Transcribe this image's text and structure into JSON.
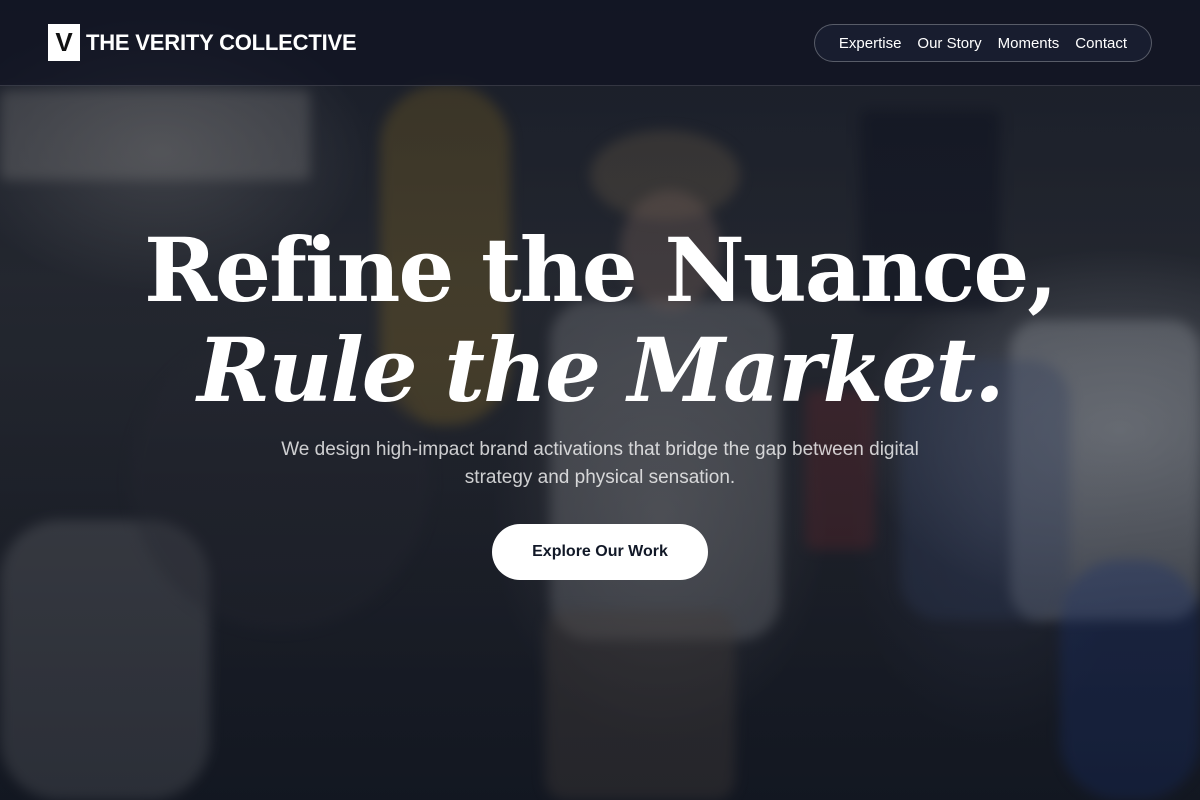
{
  "brand": {
    "mark": "V",
    "name": "THE VERITY COLLECTIVE"
  },
  "nav": {
    "items": [
      {
        "label": "Expertise"
      },
      {
        "label": "Our Story"
      },
      {
        "label": "Moments"
      },
      {
        "label": "Contact"
      }
    ]
  },
  "hero": {
    "headline_line1": "Refine the Nuance,",
    "headline_line2": "Rule the Market.",
    "subtitle": "We design high-impact brand activations that bridge the gap between digital strategy and physical sensation.",
    "cta_label": "Explore Our Work"
  },
  "colors": {
    "header_bg": "#101422",
    "text": "#ffffff",
    "cta_bg": "#ffffff",
    "cta_text": "#111827"
  }
}
